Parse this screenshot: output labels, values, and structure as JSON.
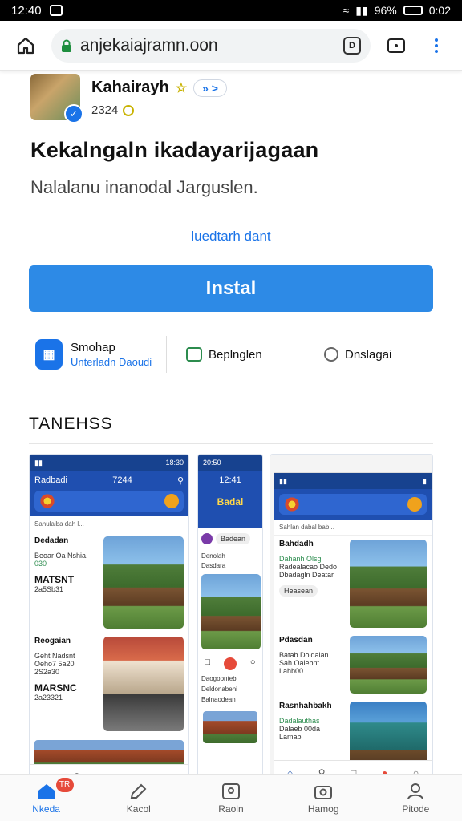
{
  "status": {
    "time": "12:40",
    "battery": "96%",
    "clock_right": "0:02"
  },
  "browser": {
    "url": "anjekaiajramn.oon"
  },
  "app": {
    "developer": "Kahairayh",
    "share_label": "» >",
    "year": "2324",
    "title": "Kekalngaln ikadayarijagaan",
    "subtitle": "Nalalanu inanodal Jarguslen.",
    "link": "luedtarh dant",
    "install_label": "Instal"
  },
  "info": {
    "store_title": "Smohap",
    "store_sub": "Unterladn Daoudi",
    "middle": "Beplnglen",
    "right": "Dnslagai"
  },
  "section_title": "TANEHSS",
  "shots": {
    "shot1": {
      "status_time": "18:30",
      "header_title": "Radbadi",
      "header_time": "7244",
      "breadcrumb": "Sahulaiba dah l...",
      "card1_title": "Dedadan",
      "card1_line1": "Beoar Oa Nshia.",
      "card1_line2": "030",
      "card1_big": "MATSNT",
      "card1_small": "2a5Sb31",
      "card2_title": "Reogaian",
      "card2_line1": "Geht Nadsnt",
      "card2_line2": "Oeho7 5a20",
      "card2_line3": "2S2a30",
      "card2_big": "MARSNC",
      "card2_small": "2a23321"
    },
    "shot2": {
      "status_time": "20:50",
      "header_time": "12:41",
      "banner_text": "Badal",
      "item1": "Badean",
      "item2": "Denolah",
      "item3": "Dasdara",
      "list1": "Daogoonteb",
      "list2": "Deldonabeni",
      "list3": "Balnaodean"
    },
    "shot3": {
      "breadcrumb": "Sahlan dabal bab...",
      "card1_title": "Bahdadh",
      "card1_line1": "Dahanh Olsg",
      "card1_line2": "Radealacao Dedo",
      "card1_line3": "Dbadagln Deatar",
      "tag1": "Heasean",
      "card2_title": "Pdasdan",
      "card2_line1": "Batab Doldalan",
      "card2_line2": "Sah Oalebnt",
      "card2_line3": "Lahb00",
      "card3_title": "Rasnhahbakh",
      "card3_line1": "Dadalauthas",
      "card3_line2": "Dalaeb 00da",
      "card3_line3": "Lamab"
    }
  },
  "bottom_nav": [
    {
      "label": "Nkeda",
      "badge": "TR"
    },
    {
      "label": "Kacol"
    },
    {
      "label": "Raoln"
    },
    {
      "label": "Hamog"
    },
    {
      "label": "Pitode"
    }
  ],
  "colors": {
    "accent": "#1a73e8",
    "install": "#2d8ae6",
    "header_dark": "#17428f"
  }
}
